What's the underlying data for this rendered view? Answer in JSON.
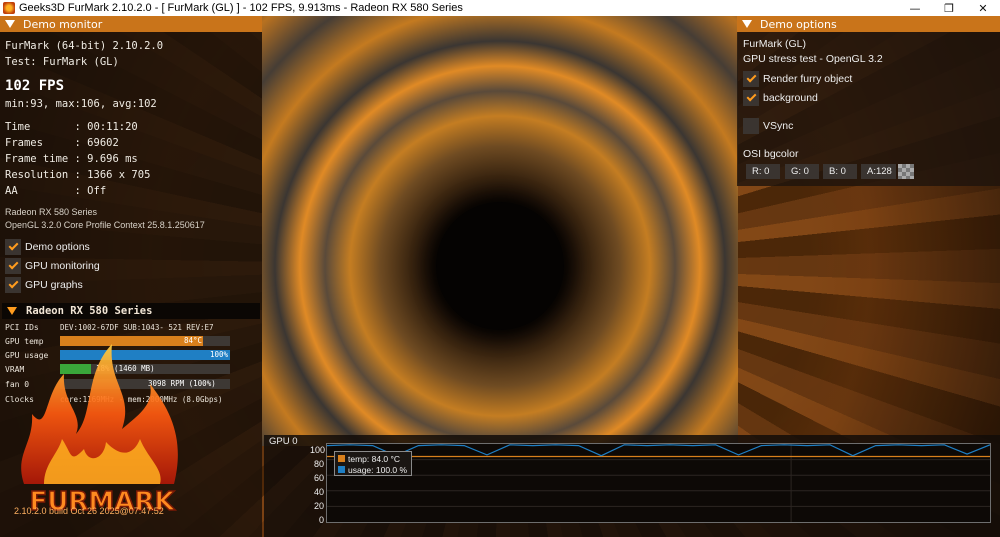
{
  "window": {
    "title": "Geeks3D FurMark 2.10.2.0 - [ FurMark (GL) ] - 102 FPS, 9.913ms - Radeon RX 580 Series",
    "minimize": "—",
    "maximize": "❐",
    "close": "✕"
  },
  "monitor": {
    "header": "Demo monitor",
    "app_line": "FurMark (64-bit) 2.10.2.0",
    "test_line": "Test: FurMark (GL)",
    "fps": "102 FPS",
    "fps_stats": "min:93, max:106, avg:102",
    "stats": [
      {
        "label": "Time       : 00:11:20"
      },
      {
        "label": "Frames     : 69602"
      },
      {
        "label": "Frame time : 9.696 ms"
      },
      {
        "label": "Resolution : 1366 x 705"
      },
      {
        "label": "AA         : Off"
      }
    ],
    "gpu_name": "Radeon RX 580 Series",
    "gl_info": "OpenGL 3.2.0 Core Profile Context 25.8.1.250617",
    "toggles": [
      {
        "label": "Demo options",
        "checked": true
      },
      {
        "label": "GPU monitoring",
        "checked": true
      },
      {
        "label": "GPU graphs",
        "checked": true
      }
    ]
  },
  "gpu": {
    "header": "Radeon RX 580 Series",
    "pci_label": "PCI IDs",
    "pci_value": "DEV:1002-67DF SUB:1043- 521 REV:E7",
    "temp_label": "GPU temp",
    "temp_value": "84°C",
    "temp_fraction": 0.84,
    "usage_label": "GPU usage",
    "usage_value": "100%",
    "usage_fraction": 1.0,
    "vram_label": "VRAM",
    "vram_value": "18% (1460 MB)",
    "vram_fraction": 0.18,
    "fan_label": "fan 0",
    "fan_value": "3098 RPM (100%)",
    "clocks_label": "Clocks",
    "clocks_value": "core:1169MHz - mem:2000MHz (8.0Gbps)",
    "colors": {
      "temp": "#d9801c",
      "usage": "#1f7fc4",
      "vram": "#3aa63a"
    }
  },
  "logo": {
    "text": "FURMARK"
  },
  "build": "2.10.2.0 build Oct 26 2025@07:47:52",
  "options": {
    "header": "Demo options",
    "demo_name": "FurMark (GL)",
    "demo_desc": "GPU stress test - OpenGL 3.2",
    "checks": [
      {
        "label": "Render furry object",
        "checked": true
      },
      {
        "label": "background",
        "checked": true
      },
      {
        "label": "VSync",
        "checked": false
      }
    ],
    "bgcolor_label": "OSI bgcolor",
    "rgba": [
      {
        "label": "R: 0"
      },
      {
        "label": "G: 0"
      },
      {
        "label": "B: 0"
      },
      {
        "label": "A:128"
      }
    ]
  },
  "graph": {
    "title": "GPU 0",
    "yticks": [
      "100",
      "80",
      "60",
      "40",
      "20",
      "0"
    ],
    "legend": [
      {
        "label": "temp: 84.0 °C",
        "color": "#d9801c"
      },
      {
        "label": "usage: 100.0 %",
        "color": "#1f7fc4"
      }
    ]
  },
  "chart_data": {
    "type": "line",
    "title": "GPU 0",
    "ylim": [
      0,
      100
    ],
    "series": [
      {
        "name": "temp: 84.0 °C",
        "values": [
          84,
          84,
          84,
          84,
          84,
          84,
          84,
          84,
          84,
          84,
          84,
          84,
          84,
          84,
          84,
          84,
          84,
          84,
          84,
          84,
          84,
          84,
          84,
          84,
          84,
          84,
          84,
          84,
          84,
          84
        ]
      },
      {
        "name": "usage: 100.0 %",
        "values": [
          98,
          99,
          98,
          85,
          98,
          99,
          98,
          86,
          99,
          98,
          99,
          98,
          85,
          99,
          98,
          99,
          98,
          99,
          86,
          98,
          99,
          98,
          99,
          85,
          98,
          99,
          98,
          99,
          87,
          99
        ]
      }
    ]
  }
}
